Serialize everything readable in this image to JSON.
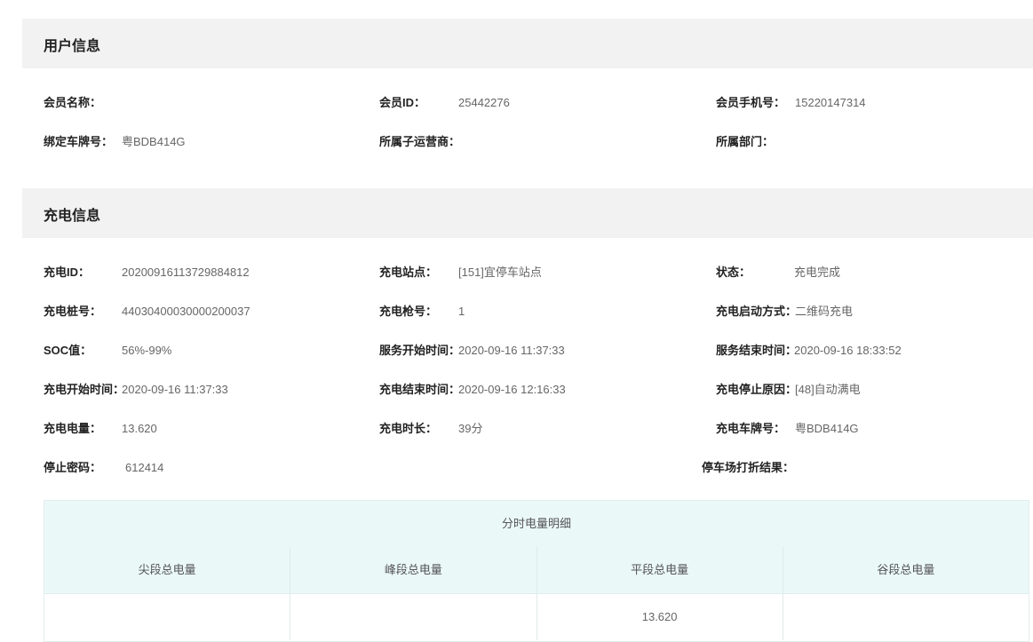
{
  "user_section": {
    "title": "用户信息",
    "fields": {
      "member_name": {
        "label": "会员名称：",
        "value": ""
      },
      "member_id": {
        "label": "会员ID：",
        "value": "25442276"
      },
      "member_phone": {
        "label": "会员手机号：",
        "value": "15220147314"
      },
      "bound_plate": {
        "label": "绑定车牌号：",
        "value": "粤BDB414G"
      },
      "sub_operator": {
        "label": "所属子运营商：",
        "value": ""
      },
      "department": {
        "label": "所属部门：",
        "value": ""
      }
    }
  },
  "charge_section": {
    "title": "充电信息",
    "fields": {
      "charge_id": {
        "label": "充电ID：",
        "value": "20200916113729884812"
      },
      "station": {
        "label": "充电站点：",
        "value": "[151]宜停车站点"
      },
      "status": {
        "label": "状态：",
        "value": "充电完成"
      },
      "pile_no": {
        "label": "充电桩号：",
        "value": "44030400030000200037"
      },
      "gun_no": {
        "label": "充电枪号：",
        "value": "1"
      },
      "start_mode": {
        "label": "充电启动方式：",
        "value": "二维码充电"
      },
      "soc": {
        "label": "SOC值：",
        "value": "56%-99%"
      },
      "service_start": {
        "label": "服务开始时间：",
        "value": "2020-09-16 11:37:33"
      },
      "service_end": {
        "label": "服务结束时间：",
        "value": "2020-09-16 18:33:52"
      },
      "charge_start": {
        "label": "充电开始时间：",
        "value": "2020-09-16 11:37:33"
      },
      "charge_end": {
        "label": "充电结束时间：",
        "value": "2020-09-16 12:16:33"
      },
      "stop_reason": {
        "label": "充电停止原因：",
        "value": "[48]自动满电"
      },
      "energy": {
        "label": "充电电量：",
        "value": "13.620"
      },
      "duration": {
        "label": "充电时长：",
        "value": "39分"
      },
      "charge_plate": {
        "label": "充电车牌号：",
        "value": "粤BDB414G"
      },
      "stop_password": {
        "label": "停止密码：",
        "value": "612414"
      },
      "parking_discount": {
        "label": "停车场打折结果：",
        "value": ""
      }
    }
  },
  "detail_table": {
    "title": "分时电量明细",
    "headers": [
      "尖段总电量",
      "峰段总电量",
      "平段总电量",
      "谷段总电量"
    ],
    "row": [
      "",
      "",
      "13.620",
      ""
    ]
  }
}
